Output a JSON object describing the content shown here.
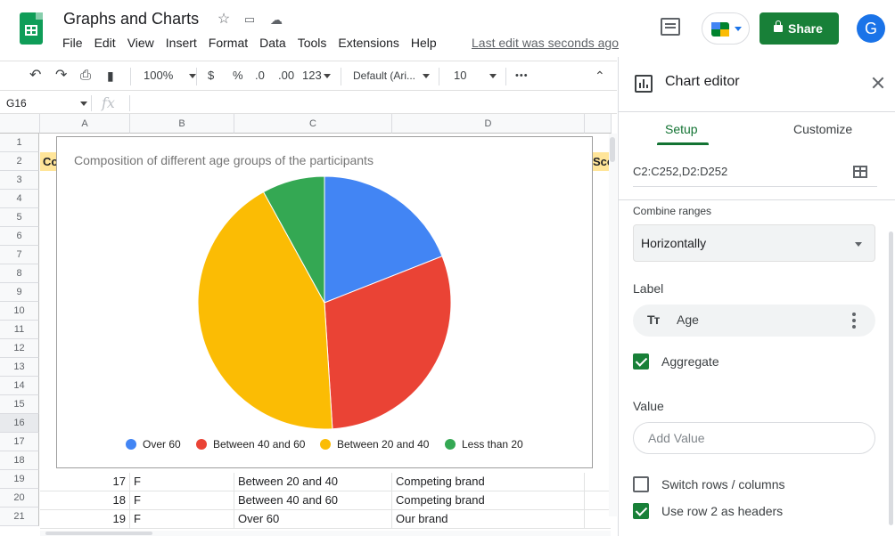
{
  "header": {
    "doc_title": "Graphs and Charts",
    "menu": [
      "File",
      "Edit",
      "View",
      "Insert",
      "Format",
      "Data",
      "Tools",
      "Extensions",
      "Help"
    ],
    "last_edit": "Last edit was seconds ago",
    "share_label": "Share",
    "avatar_initial": "G"
  },
  "toolbar": {
    "zoom": "100%",
    "currency": "$",
    "percent": "%",
    "dec_decrease": ".0",
    "dec_increase": ".00",
    "number_format": "123",
    "font": "Default (Ari...",
    "font_size": "10",
    "more": "•••"
  },
  "formula_bar": {
    "cell_ref": "G16",
    "fx": "fx"
  },
  "grid": {
    "columns": [
      "A",
      "B",
      "C",
      "D"
    ],
    "row_numbers": [
      "1",
      "2",
      "3",
      "4",
      "5",
      "6",
      "7",
      "8",
      "9",
      "10",
      "11",
      "12",
      "13",
      "14",
      "15",
      "16",
      "17",
      "18",
      "19",
      "20",
      "21"
    ],
    "row2_left": "Co",
    "row2_right": "Sco",
    "rows": [
      {
        "num": "19",
        "a": "17",
        "b": "F",
        "c": "Between 20 and 40",
        "d": "Competing brand"
      },
      {
        "num": "20",
        "a": "18",
        "b": "F",
        "c": "Between 40 and 60",
        "d": "Competing brand"
      },
      {
        "num": "21",
        "a": "19",
        "b": "F",
        "c": "Over 60",
        "d": "Our brand"
      }
    ]
  },
  "chart_data": {
    "type": "pie",
    "title": "Composition of different age groups of the participants",
    "categories": [
      "Over 60",
      "Between 40 and 60",
      "Between 20 and 40",
      "Less than 20"
    ],
    "values": [
      19,
      30,
      43,
      8
    ],
    "colors": [
      "#4285f4",
      "#ea4335",
      "#fbbc04",
      "#34a853"
    ],
    "legend_position": "bottom"
  },
  "panel": {
    "title": "Chart editor",
    "tabs": [
      "Setup",
      "Customize"
    ],
    "data_range": "C2:C252,D2:D252",
    "combine_label": "Combine ranges",
    "combine_value": "Horizontally",
    "label_heading": "Label",
    "label_chip": "Age",
    "aggregate_label": "Aggregate",
    "value_heading": "Value",
    "add_value_label": "Add Value",
    "switch_label": "Switch rows / columns",
    "headers_label": "Use row 2 as headers"
  }
}
